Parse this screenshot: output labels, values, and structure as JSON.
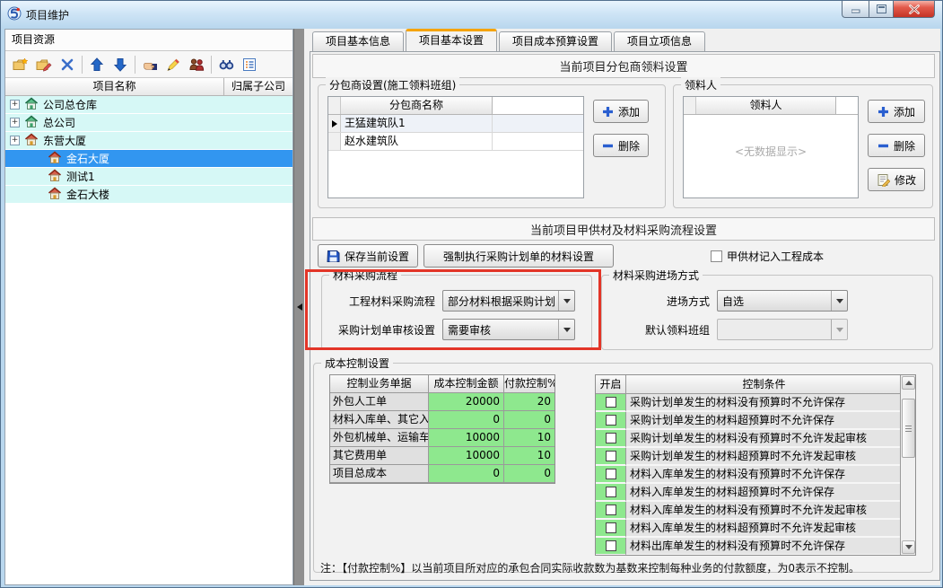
{
  "window": {
    "title": "项目维护"
  },
  "left_panel": {
    "header": "项目资源",
    "toolbar": [
      "new-folder",
      "edit-folder",
      "delete",
      "|",
      "move-up",
      "move-down",
      "|",
      "assign",
      "edit-pencil",
      "members",
      "|",
      "search",
      "view-options"
    ],
    "tree": {
      "columns": [
        "项目名称",
        "归属子公司"
      ],
      "rows": [
        {
          "label": "公司总仓库",
          "level": 0,
          "expandable": true,
          "icon": "green",
          "selected": false
        },
        {
          "label": "总公司",
          "level": 0,
          "expandable": true,
          "icon": "green",
          "selected": false
        },
        {
          "label": "东营大厦",
          "level": 0,
          "expandable": true,
          "icon": "red",
          "selected": false
        },
        {
          "label": "金石大厦",
          "level": 1,
          "expandable": false,
          "icon": "red",
          "selected": true
        },
        {
          "label": "测试1",
          "level": 1,
          "expandable": false,
          "icon": "red",
          "selected": false
        },
        {
          "label": "金石大楼",
          "level": 1,
          "expandable": false,
          "icon": "red",
          "selected": false
        }
      ]
    }
  },
  "tabs": [
    {
      "label": "项目基本信息",
      "active": false
    },
    {
      "label": "项目基本设置",
      "active": true
    },
    {
      "label": "项目成本预算设置",
      "active": false
    },
    {
      "label": "项目立项信息",
      "active": false
    }
  ],
  "section1": {
    "title": "当前项目分包商领料设置",
    "subcontractor_group": {
      "title": "分包商设置(施工领料班组)",
      "column": "分包商名称",
      "rows": [
        "王猛建筑队1",
        "赵水建筑队"
      ],
      "add_label": "添加",
      "delete_label": "删除"
    },
    "picker_group": {
      "title": "领料人",
      "column": "领料人",
      "empty_text": "<无数据显示>",
      "add_label": "添加",
      "delete_label": "删除",
      "modify_label": "修改"
    }
  },
  "section2": {
    "title": "当前项目甲供材及材料采购流程设置",
    "save_button": "保存当前设置",
    "force_button": "强制执行采购计划单的材料设置",
    "owner_material_checkbox": {
      "label": "甲供材记入工程成本",
      "checked": false
    },
    "procurement_flow": {
      "title": "材料采购流程",
      "fields": [
        {
          "label": "工程材料采购流程",
          "value": "部分材料根据采购计划",
          "disabled": false
        },
        {
          "label": "采购计划单审核设置",
          "value": "需要审核",
          "disabled": false
        }
      ]
    },
    "entry_mode": {
      "title": "材料采购进场方式",
      "fields": [
        {
          "label": "进场方式",
          "value": "自选",
          "disabled": false
        },
        {
          "label": "默认领料班组",
          "value": "",
          "disabled": true
        }
      ]
    },
    "cost_control": {
      "title": "成本控制设置",
      "columns": [
        "控制业务单据",
        "成本控制金额",
        "付款控制%"
      ],
      "rows": [
        {
          "name": "外包人工单",
          "amount": "20000",
          "pct": "20"
        },
        {
          "name": "材料入库单、其它入",
          "amount": "0",
          "pct": "0"
        },
        {
          "name": "外包机械单、运输车",
          "amount": "10000",
          "pct": "10"
        },
        {
          "name": "其它费用单",
          "amount": "10000",
          "pct": "10"
        },
        {
          "name": "项目总成本",
          "amount": "0",
          "pct": "0"
        }
      ]
    },
    "conditions": {
      "columns": [
        "开启",
        "控制条件"
      ],
      "rows": [
        {
          "checked": false,
          "text": "采购计划单发生的材料没有预算时不允许保存"
        },
        {
          "checked": false,
          "text": "采购计划单发生的材料超预算时不允许保存"
        },
        {
          "checked": false,
          "text": "采购计划单发生的材料没有预算时不允许发起审核"
        },
        {
          "checked": false,
          "text": "采购计划单发生的材料超预算时不允许发起审核"
        },
        {
          "checked": false,
          "text": "材料入库单发生的材料没有预算时不允许保存"
        },
        {
          "checked": false,
          "text": "材料入库单发生的材料超预算时不允许保存"
        },
        {
          "checked": false,
          "text": "材料入库单发生的材料没有预算时不允许发起审核"
        },
        {
          "checked": false,
          "text": "材料入库单发生的材料超预算时不允许发起审核"
        },
        {
          "checked": false,
          "text": "材料出库单发生的材料没有预算时不允许保存"
        }
      ]
    },
    "note": "注：【付款控制%】以当前项目所对应的承包合同实际收款数为基数来控制每种业务的付款额度，为0表示不控制。",
    "colors": {
      "accent_orange": "#f5a300",
      "grid_green": "#8ee88e",
      "selection_blue": "#3296f0",
      "annotation_red": "#e33528",
      "tree_row_cyan": "#d6f8f6"
    }
  }
}
